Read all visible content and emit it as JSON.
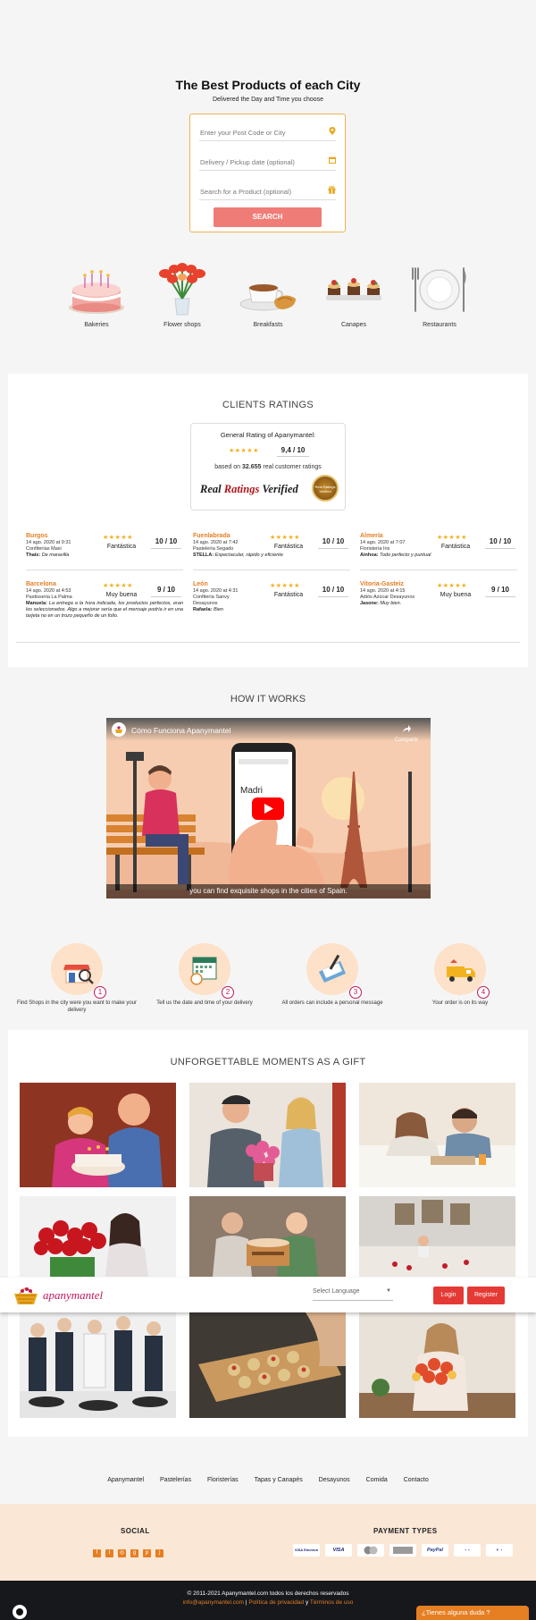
{
  "hero": {
    "title": "The Best Products of each City",
    "subtitle": "Delivered the Day and Time you choose",
    "search": {
      "postcode_placeholder": "Enter your Post Code or City",
      "date_placeholder": "Delivery / Pickup date (optional)",
      "product_placeholder": "Search for a Product (optional)",
      "button": "SEARCH"
    },
    "categories": [
      "Bakeries",
      "Flower shops",
      "Breakfasts",
      "Canapes",
      "Restaurants"
    ]
  },
  "ratings": {
    "title": "CLIENTS RATINGS",
    "general_label": "General Rating of Apanymantel:",
    "general_stars": "★★★★★",
    "general_score": "9,4 / 10",
    "based_prefix": "based on ",
    "based_count": "32.655",
    "based_suffix": " real customer ratings",
    "rrv_a": "Real ",
    "rrv_b": "Ratings",
    "rrv_c": " Verified",
    "seal_text": "Real Ratings Verified",
    "reviews": [
      {
        "city": "Burgos",
        "date": "14 ago. 2020 at 9:31",
        "shop": "Confiterías Maxi",
        "author": "Thais:",
        "comment": "De maravilla",
        "stars": "★★★★★",
        "label": "Fantástica",
        "score": "10 / 10"
      },
      {
        "city": "Fuenlabrada",
        "date": "14 ago. 2020 at 7:42",
        "shop": "Pastelería Segado",
        "author": "STELLA:",
        "comment": "Espectacular, rápido y eficiente",
        "stars": "★★★★★",
        "label": "Fantástica",
        "score": "10 / 10"
      },
      {
        "city": "Almería",
        "date": "14 ago. 2020 at 7:07",
        "shop": "Floristería Iris",
        "author": "Ainhoa:",
        "comment": "Todo perfecto y puntual",
        "stars": "★★★★★",
        "label": "Fantástica",
        "score": "10 / 10"
      },
      {
        "city": "Barcelona",
        "date": "14 ago. 2020 at 4:53",
        "shop": "Pastisseria La Palma",
        "author": "Manuela:",
        "comment": "La entrega a la hora indicada, los productos perfectos, eran los seleccionados. Algo a mejorar sería que el mensaje podría ir en una tarjeta no en un trozo pequeño de un folio.",
        "stars": "★★★★★",
        "label": "Muy buena",
        "score": "9 / 10"
      },
      {
        "city": "León",
        "date": "14 ago. 2020 at 4:31",
        "shop": "Confitería Sanvy",
        "shop2": "Desayunos",
        "author": "Rafaela:",
        "comment": "Bien",
        "stars": "★★★★★",
        "label": "Fantástica",
        "score": "10 / 10"
      },
      {
        "city": "Vitoria-Gasteiz",
        "date": "14 ago. 2020 at 4:15",
        "shop": "Adiós Azúcar Desayunos",
        "author": "Jasone:",
        "comment": "Muy bien.",
        "stars": "★★★★★",
        "label": "Muy buena",
        "score": "9 / 10"
      }
    ]
  },
  "how": {
    "title": "HOW IT WORKS",
    "video_title": "Cómo Funciona Apanymantel",
    "video_share": "Compartir",
    "video_caption": "you can find exquisite shops in the cities of Spain.",
    "video_city": "Madri",
    "steps": [
      {
        "num": "1",
        "label": "Find Shops in the city were you want to make your delivery"
      },
      {
        "num": "2",
        "label": "Tell us the date and time of your delivery"
      },
      {
        "num": "3",
        "label": "All orders can include a personal message"
      },
      {
        "num": "4",
        "label": "Your order is on its way"
      }
    ]
  },
  "gifts": {
    "title": "UNFORGETTABLE MOMENTS AS A GIFT"
  },
  "header": {
    "logo": "apanymantel",
    "language_placeholder": "Select Language",
    "login": "Login",
    "register": "Register"
  },
  "footer": {
    "nav": [
      "Apanymantel",
      "Pastelerías",
      "Floristerías",
      "Tapas y Canapés",
      "Desayunos",
      "Comida",
      "Contacto"
    ],
    "social_title": "SOCIAL",
    "payment_title": "PAYMENT TYPES",
    "payments": [
      "VISA Electron",
      "VISA",
      "MC",
      "AMEX",
      "PayPal",
      "",
      ""
    ],
    "copyright": "© 2011-2021 Apanymantel.com todos los derechos reservados",
    "email": "info@apanymantel.com",
    "sep": " | ",
    "privacy": "Política de privacidad",
    "and": " y ",
    "terms": "Términos de uso",
    "chat": "¿Tienes alguna duda ?"
  },
  "colors": {
    "accent": "#e67e22",
    "brand": "#c2185b",
    "button_red": "#e53935",
    "search_button": "#f07c78"
  }
}
